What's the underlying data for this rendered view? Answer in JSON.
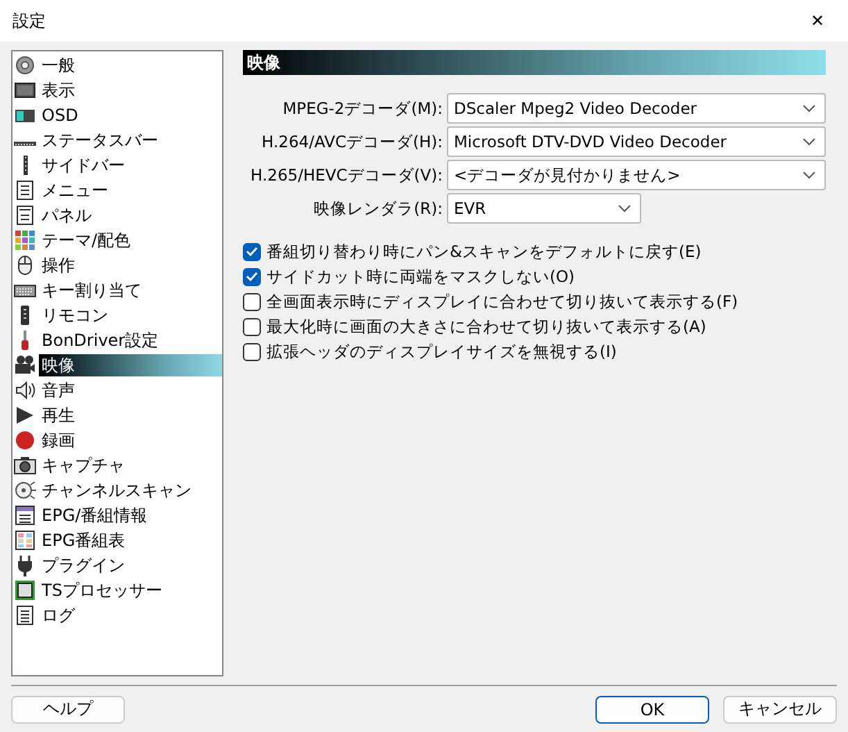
{
  "window": {
    "title": "設定",
    "close": "✕"
  },
  "sidebar": {
    "items": [
      {
        "label": "一般",
        "selected": false
      },
      {
        "label": "表示",
        "selected": false
      },
      {
        "label": "OSD",
        "selected": false
      },
      {
        "label": "ステータスバー",
        "selected": false
      },
      {
        "label": "サイドバー",
        "selected": false
      },
      {
        "label": "メニュー",
        "selected": false
      },
      {
        "label": "パネル",
        "selected": false
      },
      {
        "label": "テーマ/配色",
        "selected": false
      },
      {
        "label": "操作",
        "selected": false
      },
      {
        "label": "キー割り当て",
        "selected": false
      },
      {
        "label": "リモコン",
        "selected": false
      },
      {
        "label": "BonDriver設定",
        "selected": false
      },
      {
        "label": "映像",
        "selected": true
      },
      {
        "label": "音声",
        "selected": false
      },
      {
        "label": "再生",
        "selected": false
      },
      {
        "label": "録画",
        "selected": false
      },
      {
        "label": "キャプチャ",
        "selected": false
      },
      {
        "label": "チャンネルスキャン",
        "selected": false
      },
      {
        "label": "EPG/番組情報",
        "selected": false
      },
      {
        "label": "EPG番組表",
        "selected": false
      },
      {
        "label": "プラグイン",
        "selected": false
      },
      {
        "label": "TSプロセッサー",
        "selected": false
      },
      {
        "label": "ログ",
        "selected": false
      }
    ]
  },
  "panel": {
    "heading": "映像",
    "selects": [
      {
        "label": "MPEG-2デコーダ(M):",
        "value": "DScaler Mpeg2 Video Decoder",
        "wide": true
      },
      {
        "label": "H.264/AVCデコーダ(H):",
        "value": "Microsoft DTV-DVD Video Decoder",
        "wide": true
      },
      {
        "label": "H.265/HEVCデコーダ(V):",
        "value": "<デコーダが見付かりません>",
        "wide": true
      },
      {
        "label": "映像レンダラ(R):",
        "value": "EVR",
        "wide": false
      }
    ],
    "checkboxes": [
      {
        "label": "番組切り替わり時にパン&スキャンをデフォルトに戻す(E)",
        "checked": true
      },
      {
        "label": "サイドカット時に両端をマスクしない(O)",
        "checked": true
      },
      {
        "label": "全画面表示時にディスプレイに合わせて切り抜いて表示する(F)",
        "checked": false
      },
      {
        "label": "最大化時に画面の大きさに合わせて切り抜いて表示する(A)",
        "checked": false
      },
      {
        "label": "拡張ヘッダのディスプレイサイズを無視する(I)",
        "checked": false
      }
    ]
  },
  "buttons": {
    "help": "ヘルプ",
    "ok": "OK",
    "cancel": "キャンセル"
  }
}
